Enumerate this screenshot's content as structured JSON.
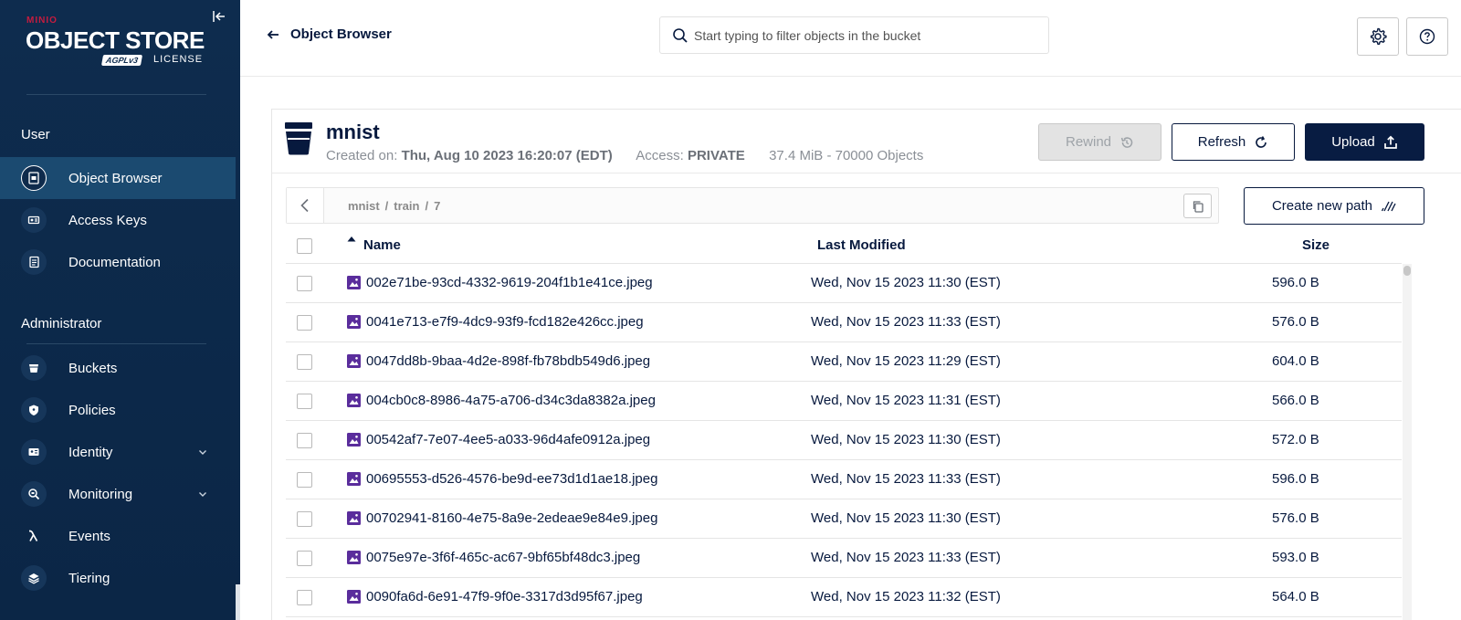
{
  "brand": {
    "minio": "MINIO",
    "product": "OBJECT STORE",
    "license_badge": "AGPLv3",
    "license": "LICENSE"
  },
  "sidebar": {
    "user_section": "User",
    "admin_section": "Administrator",
    "user_items": [
      {
        "label": "Object Browser",
        "icon": "object-browser-icon",
        "active": true
      },
      {
        "label": "Access Keys",
        "icon": "key-icon",
        "active": false
      },
      {
        "label": "Documentation",
        "icon": "document-icon",
        "active": false
      }
    ],
    "admin_items": [
      {
        "label": "Buckets",
        "icon": "bucket-icon",
        "expandable": false
      },
      {
        "label": "Policies",
        "icon": "shield-icon",
        "expandable": false
      },
      {
        "label": "Identity",
        "icon": "id-card-icon",
        "expandable": true
      },
      {
        "label": "Monitoring",
        "icon": "monitor-search-icon",
        "expandable": true
      },
      {
        "label": "Events",
        "icon": "lambda-icon",
        "expandable": false
      },
      {
        "label": "Tiering",
        "icon": "layers-icon",
        "expandable": false
      }
    ]
  },
  "topbar": {
    "back_label": "Object Browser",
    "search_placeholder": "Start typing to filter objects in the bucket",
    "search_value": ""
  },
  "bucket": {
    "name": "mnist",
    "created_label": "Created on:",
    "created_value": "Thu, Aug 10 2023 16:20:07 (EDT)",
    "access_label": "Access:",
    "access_value": "PRIVATE",
    "usage": "37.4 MiB - 70000 Objects"
  },
  "actions": {
    "rewind": "Rewind",
    "refresh": "Refresh",
    "upload": "Upload",
    "create_new_path": "Create new path"
  },
  "breadcrumb": [
    "mnist",
    "train",
    "7"
  ],
  "table": {
    "columns": {
      "name": "Name",
      "last_modified": "Last Modified",
      "size": "Size"
    },
    "rows": [
      {
        "name": "002e71be-93cd-4332-9619-204f1b1e41ce.jpeg",
        "modified": "Wed, Nov 15 2023 11:30 (EST)",
        "size": "596.0 B"
      },
      {
        "name": "0041e713-e7f9-4dc9-93f9-fcd182e426cc.jpeg",
        "modified": "Wed, Nov 15 2023 11:33 (EST)",
        "size": "576.0 B"
      },
      {
        "name": "0047dd8b-9baa-4d2e-898f-fb78bdb549d6.jpeg",
        "modified": "Wed, Nov 15 2023 11:29 (EST)",
        "size": "604.0 B"
      },
      {
        "name": "004cb0c8-8986-4a75-a706-d34c3da8382a.jpeg",
        "modified": "Wed, Nov 15 2023 11:31 (EST)",
        "size": "566.0 B"
      },
      {
        "name": "00542af7-7e07-4ee5-a033-96d4afe0912a.jpeg",
        "modified": "Wed, Nov 15 2023 11:30 (EST)",
        "size": "572.0 B"
      },
      {
        "name": "00695553-d526-4576-be9d-ee73d1d1ae18.jpeg",
        "modified": "Wed, Nov 15 2023 11:33 (EST)",
        "size": "596.0 B"
      },
      {
        "name": "00702941-8160-4e75-8a9e-2edeae9e84e9.jpeg",
        "modified": "Wed, Nov 15 2023 11:30 (EST)",
        "size": "576.0 B"
      },
      {
        "name": "0075e97e-3f6f-465c-ac67-9bf65bf48dc3.jpeg",
        "modified": "Wed, Nov 15 2023 11:33 (EST)",
        "size": "593.0 B"
      },
      {
        "name": "0090fa6d-6e91-47f9-9f0e-3317d3d95f67.jpeg",
        "modified": "Wed, Nov 15 2023 11:32 (EST)",
        "size": "564.0 B"
      }
    ]
  },
  "colors": {
    "sidebar_bg": "#0e2c4e",
    "sidebar_active": "#1b4a70",
    "primary": "#081c42",
    "file_icon": "#5a2d9c",
    "brand_red": "#c51c3f"
  }
}
